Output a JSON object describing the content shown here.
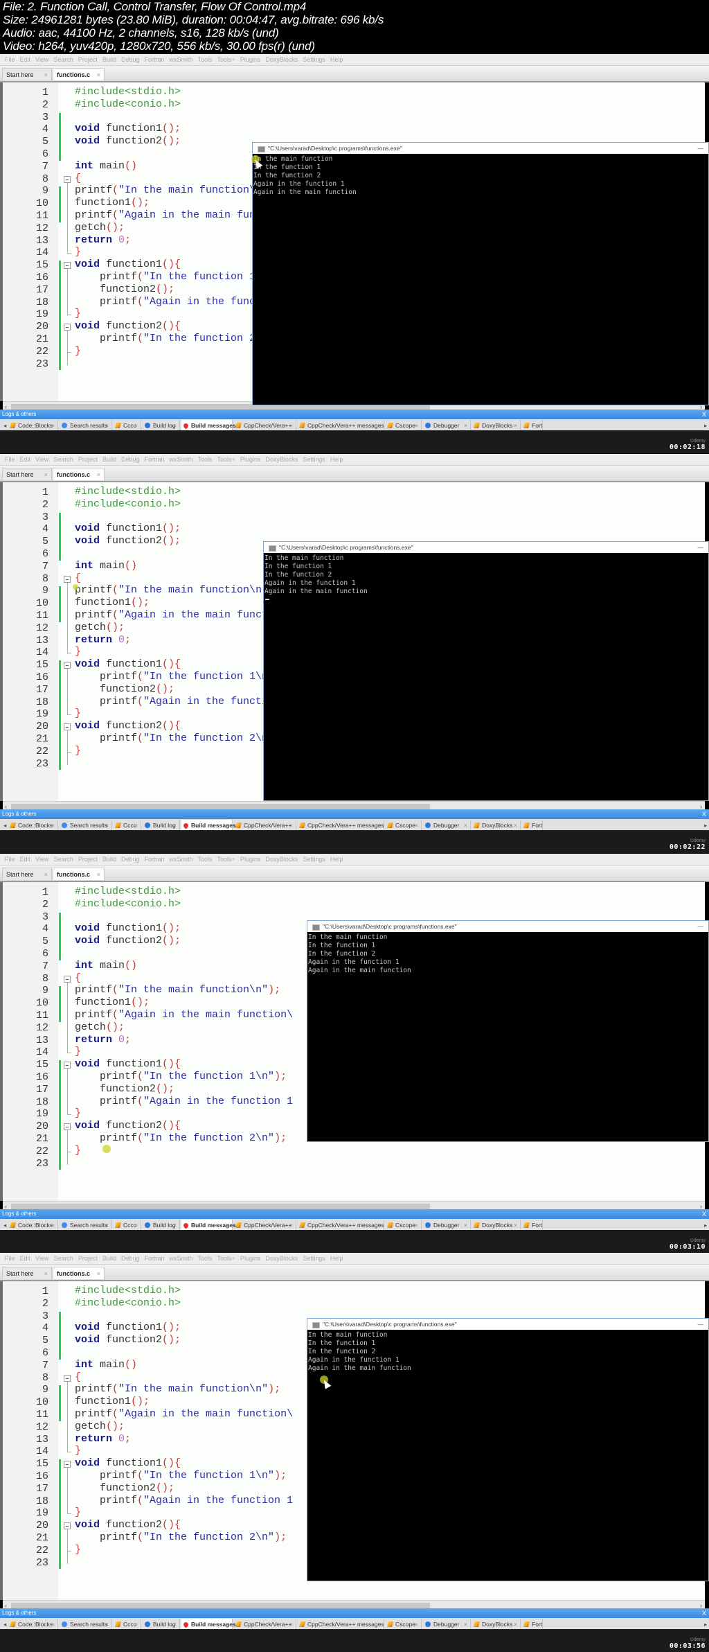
{
  "header": {
    "file": "File: 2. Function Call, Control Transfer, Flow Of Control.mp4",
    "size": "Size: 24961281 bytes (23.80 MiB), duration: 00:04:47, avg.bitrate: 696 kb/s",
    "audio": "Audio: aac, 44100 Hz, 2 channels, s16, 128 kb/s (und)",
    "video": "Video: h264, yuv420p, 1280x720, 556 kb/s, 30.00 fps(r) (und)"
  },
  "ide": {
    "menu": [
      "File",
      "Edit",
      "View",
      "Search",
      "Project",
      "Build",
      "Debug",
      "Fortran",
      "wxSmith",
      "Tools",
      "Tools+",
      "Plugins",
      "DoxyBlocks",
      "Settings",
      "Help"
    ],
    "editor_tabs": [
      {
        "label": "Start here",
        "close": "×"
      },
      {
        "label": "functions.c",
        "close": "×",
        "active": true
      }
    ],
    "line_numbers": [
      "1",
      "2",
      "3",
      "4",
      "5",
      "6",
      "7",
      "8",
      "9",
      "10",
      "11",
      "12",
      "13",
      "14",
      "15",
      "16",
      "17",
      "18",
      "19",
      "20",
      "21",
      "22",
      "23"
    ],
    "code_lines": [
      [
        {
          "t": "#include<stdio.h>",
          "c": "pp"
        }
      ],
      [
        {
          "t": "#include<conio.h>",
          "c": "pp"
        }
      ],
      [],
      [
        {
          "t": "void",
          "c": "kw"
        },
        {
          "t": " function1"
        },
        {
          "t": "();",
          "c": "pn"
        }
      ],
      [
        {
          "t": "void",
          "c": "kw"
        },
        {
          "t": " function2"
        },
        {
          "t": "();",
          "c": "pn"
        }
      ],
      [],
      [
        {
          "t": "int",
          "c": "kw"
        },
        {
          "t": " main"
        },
        {
          "t": "()",
          "c": "pn"
        }
      ],
      [
        {
          "t": "{",
          "c": "pn"
        }
      ],
      [
        {
          "t": "printf"
        },
        {
          "t": "(",
          "c": "pn"
        },
        {
          "t": "\"In the main function\\n\"",
          "c": "str"
        },
        {
          "t": ");",
          "c": "pn"
        }
      ],
      [
        {
          "t": "function1"
        },
        {
          "t": "();",
          "c": "pn"
        }
      ],
      [
        {
          "t": "printf"
        },
        {
          "t": "(",
          "c": "pn"
        },
        {
          "t": "\"Again in the main function\\",
          "c": "str"
        }
      ],
      [
        {
          "t": "getch"
        },
        {
          "t": "();",
          "c": "pn"
        }
      ],
      [
        {
          "t": "return",
          "c": "kw"
        },
        {
          "t": " "
        },
        {
          "t": "0",
          "c": "num"
        },
        {
          "t": ";",
          "c": "pn"
        }
      ],
      [
        {
          "t": "}",
          "c": "pn"
        }
      ],
      [
        {
          "t": "void",
          "c": "kw"
        },
        {
          "t": " function1"
        },
        {
          "t": "(){",
          "c": "pn"
        }
      ],
      [
        {
          "t": "    printf"
        },
        {
          "t": "(",
          "c": "pn"
        },
        {
          "t": "\"In the function 1\\n\"",
          "c": "str"
        },
        {
          "t": ");",
          "c": "pn"
        }
      ],
      [
        {
          "t": "    function2"
        },
        {
          "t": "();",
          "c": "pn"
        }
      ],
      [
        {
          "t": "    printf"
        },
        {
          "t": "(",
          "c": "pn"
        },
        {
          "t": "\"Again in the function 1",
          "c": "str"
        }
      ],
      [
        {
          "t": "}",
          "c": "pn"
        }
      ],
      [
        {
          "t": "void",
          "c": "kw"
        },
        {
          "t": " function2"
        },
        {
          "t": "(){",
          "c": "pn"
        }
      ],
      [
        {
          "t": "    printf"
        },
        {
          "t": "(",
          "c": "pn"
        },
        {
          "t": "\"In the function 2\\n\"",
          "c": "str"
        },
        {
          "t": ");",
          "c": "pn"
        }
      ],
      [
        {
          "t": "}",
          "c": "pn"
        }
      ],
      []
    ],
    "logs_panel_title": "Logs & others",
    "logs_close": "X",
    "log_tabs": [
      {
        "label": "Code::Blocks",
        "icon": "pencil"
      },
      {
        "label": "Search results",
        "icon": "mag"
      },
      {
        "label": "Cccc",
        "icon": "pencil"
      },
      {
        "label": "Build log",
        "icon": "gear"
      },
      {
        "label": "Build messages",
        "icon": "pin",
        "active": true
      },
      {
        "label": "CppCheck/Vera++",
        "icon": "pencil"
      },
      {
        "label": "CppCheck/Vera++ messages",
        "icon": "pencil"
      },
      {
        "label": "Cscope",
        "icon": "pencil"
      },
      {
        "label": "Debugger",
        "icon": "gear"
      },
      {
        "label": "DoxyBlocks",
        "icon": "pencil"
      },
      {
        "label": "Fort",
        "icon": "pencil"
      }
    ],
    "tab_close": "×",
    "scroll_left": "‹",
    "scroll_right": "›",
    "tabs_left_arrow": "◂",
    "tabs_right_arrow": "▸"
  },
  "console": {
    "title": "\"C:\\Users\\varad\\Desktop\\c programs\\functions.exe\"",
    "minimize": "—",
    "output": [
      "In the main function",
      "In the function 1",
      "In the function 2",
      "Again in the function 1",
      "Again in the main function"
    ]
  },
  "watermark": "Udemy",
  "frames": [
    {
      "timestamp": "00:02:18"
    },
    {
      "timestamp": "00:02:22"
    },
    {
      "timestamp": "00:03:10"
    },
    {
      "timestamp": "00:03:56"
    }
  ]
}
